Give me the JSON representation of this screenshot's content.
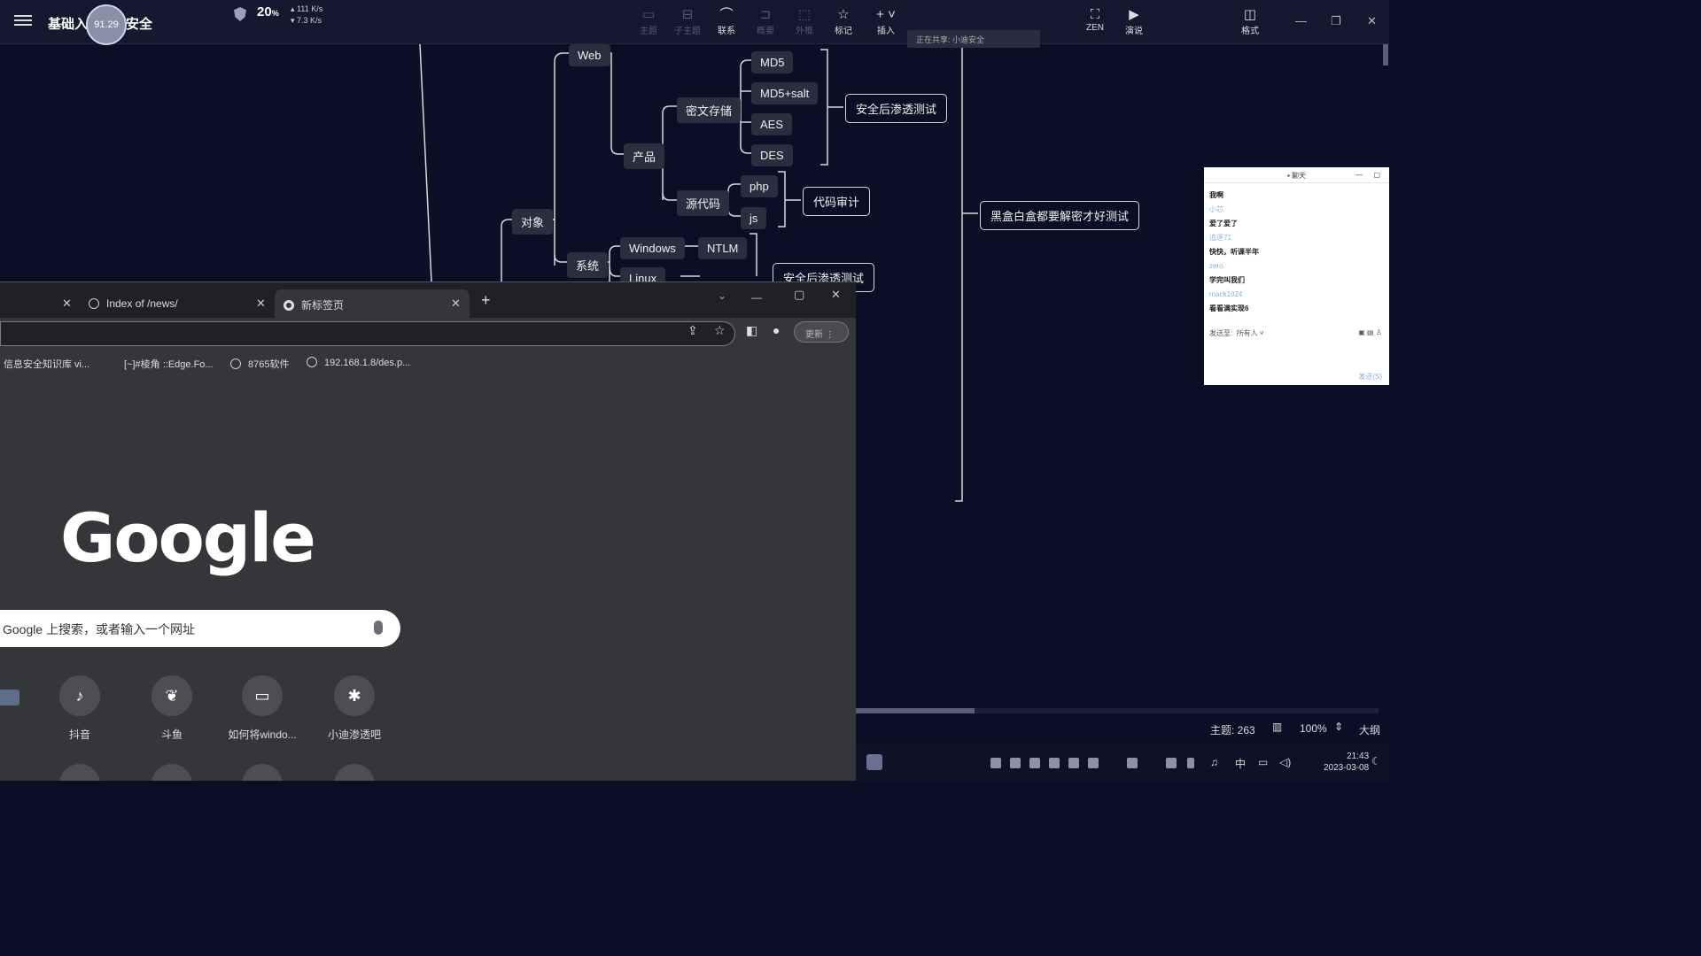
{
  "app": {
    "title_left": "基础入",
    "title_right": "安全",
    "overlay_value": "91.29",
    "cpu_percent": "20",
    "cpu_unit": "%",
    "net_up": "111 K/s",
    "net_down": "7.3 K/s"
  },
  "toolbar": {
    "items": [
      {
        "label": "主题",
        "icon": "topic-icon",
        "enabled": false
      },
      {
        "label": "子主题",
        "icon": "subtopic-icon",
        "enabled": false
      },
      {
        "label": "联系",
        "icon": "relation-icon",
        "enabled": true
      },
      {
        "label": "概要",
        "icon": "summary-icon",
        "enabled": false
      },
      {
        "label": "外框",
        "icon": "boundary-icon",
        "enabled": false
      },
      {
        "label": "标记",
        "icon": "star-icon",
        "enabled": true
      },
      {
        "label": "插入",
        "icon": "plus-icon",
        "enabled": true
      },
      {
        "label": "ZEN",
        "icon": "fullscreen-icon",
        "enabled": true
      },
      {
        "label": "演说",
        "icon": "present-icon",
        "enabled": true
      },
      {
        "label": "格式",
        "icon": "format-panel-icon",
        "enabled": true
      }
    ],
    "meeting_status": "正在共享: 小迪安全"
  },
  "mindmap": {
    "nodes": {
      "web": "Web",
      "product": "产品",
      "cipher_storage": "密文存储",
      "md5": "MD5",
      "md5salt": "MD5+salt",
      "aes": "AES",
      "des": "DES",
      "after_test_1": "安全后渗透测试",
      "source_code": "源代码",
      "php": "php",
      "js": "js",
      "code_audit": "代码审计",
      "target": "对象",
      "system": "系统",
      "windows": "Windows",
      "ntlm": "NTLM",
      "linux": "Linux",
      "after_test_2": "安全后渗透测试",
      "blackbox": "黑盒白盒都要解密才好测试"
    }
  },
  "browser": {
    "tabs": [
      {
        "label": "",
        "active": false
      },
      {
        "label": "Index of /news/",
        "active": false
      },
      {
        "label": "新标签页",
        "active": true
      }
    ],
    "profile_label": "更新",
    "bookmarks": [
      "信息安全知识库 vi...",
      "[~]#棱角 ::Edge.Fo...",
      "8765软件",
      "192.168.1.8/des.p..."
    ],
    "logo": "Google",
    "search_placeholder": "Google 上搜索，或者输入一个网址",
    "shortcuts": [
      "抖音",
      "斗鱼",
      "如何将windo...",
      "小迪渗透吧"
    ]
  },
  "chat": {
    "title": "聊天",
    "messages": [
      {
        "name": "",
        "text": "我啊"
      },
      {
        "name": "小芯",
        "text": "爱了爱了"
      },
      {
        "name": "追逐71",
        "text": "快快，听课半年"
      },
      {
        "name": "zero.",
        "text": "学完叫我们"
      },
      {
        "name": "rnack1024",
        "text": "看看满实现6"
      }
    ],
    "send_to_label": "发送至:",
    "send_to_value": "所有人",
    "send_button": "发送(S)"
  },
  "status": {
    "topic_count": "主题: 263",
    "zoom": "100%",
    "outline": "大纲"
  },
  "taskbar": {
    "ime": "中",
    "time": "21:43",
    "date": "2023-03-08"
  }
}
